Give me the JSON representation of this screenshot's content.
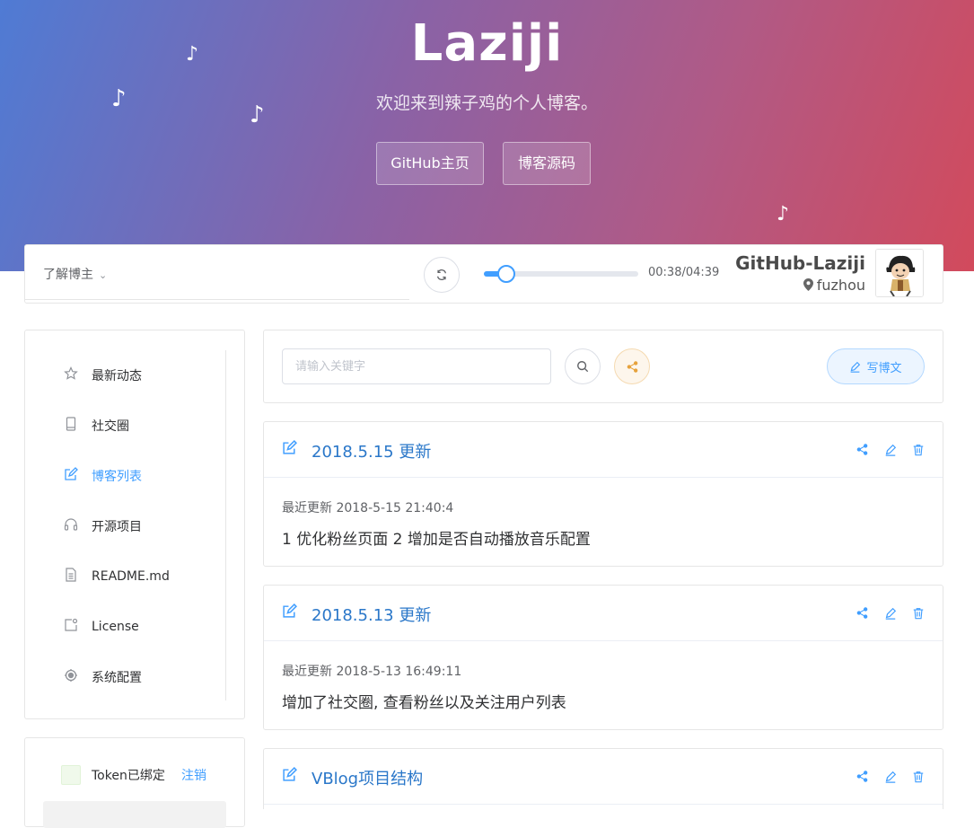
{
  "header": {
    "title": "Laziji",
    "subtitle": "欢迎来到辣子鸡的个人博客。",
    "buttons": [
      "GitHub主页",
      "博客源码"
    ],
    "note_glyph": "♪"
  },
  "player": {
    "about_label": "了解博主",
    "progress_fraction": 0.148,
    "time": "00:38/04:39",
    "github_name": "GitHub-Laziji",
    "location": "fuzhou"
  },
  "sidebar": {
    "items": [
      {
        "label": "最新动态",
        "icon": "star-icon"
      },
      {
        "label": "社交圈",
        "icon": "mobile-icon"
      },
      {
        "label": "博客列表",
        "icon": "edit-icon",
        "active": true
      },
      {
        "label": "开源项目",
        "icon": "headset-icon"
      },
      {
        "label": "README.md",
        "icon": "document-icon"
      },
      {
        "label": "License",
        "icon": "badge-icon"
      },
      {
        "label": "系统配置",
        "icon": "settings-icon"
      }
    ]
  },
  "token": {
    "status": "Token已绑定",
    "logout": "注销"
  },
  "search": {
    "placeholder": "请输入关键字",
    "write_label": "写博文"
  },
  "posts": [
    {
      "title": "2018.5.15 更新",
      "meta": "最近更新 2018-5-15 21:40:4",
      "desc": "1 优化粉丝页面 2 增加是否自动播放音乐配置"
    },
    {
      "title": "2018.5.13 更新",
      "meta": "最近更新 2018-5-13 16:49:11",
      "desc": "增加了社交圈, 查看粉丝以及关注用户列表"
    },
    {
      "title": "VBlog项目结构",
      "meta": "",
      "desc": ""
    }
  ],
  "colors": {
    "accent": "#409eff",
    "title_blue": "#2a77c9",
    "share_orange": "#e6a23c"
  }
}
